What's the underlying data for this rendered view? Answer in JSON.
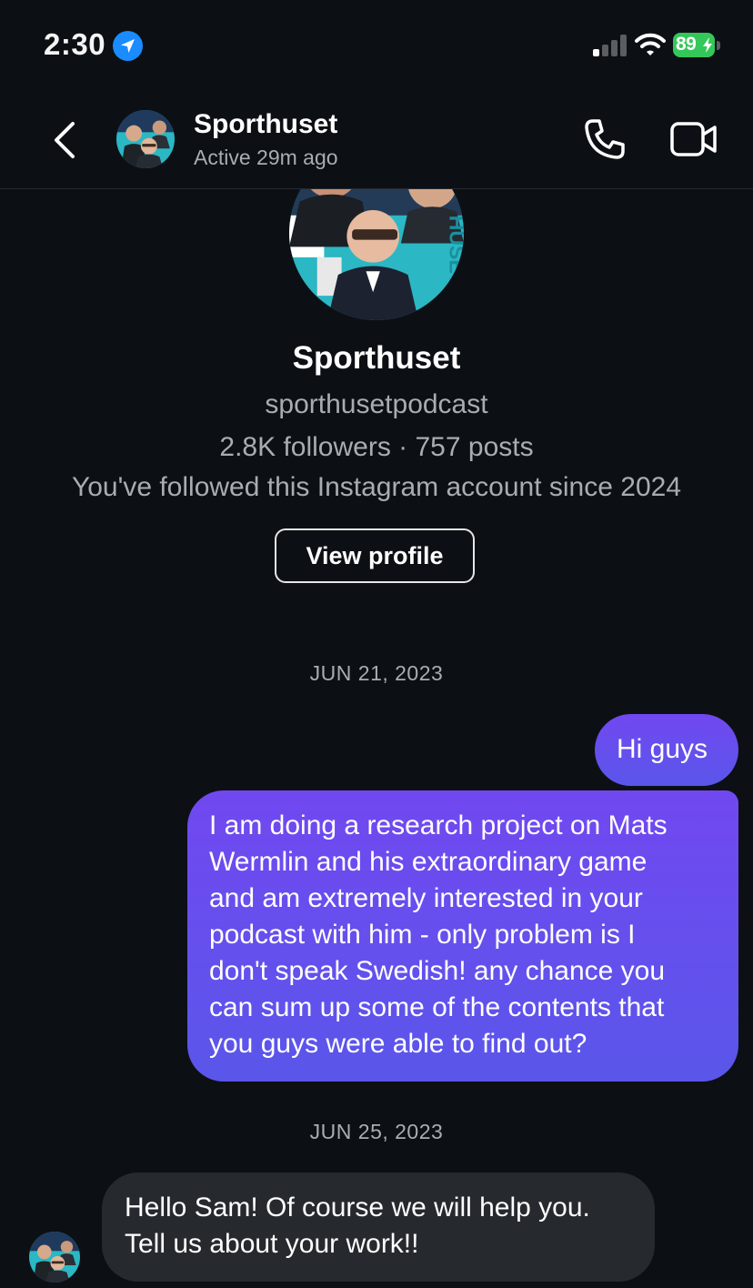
{
  "status_bar": {
    "time": "2:30",
    "battery": "89",
    "location_icon": "location-arrow-icon",
    "signal_icon": "cellular-signal-icon",
    "wifi_icon": "wifi-icon",
    "battery_color": "#34c759"
  },
  "header": {
    "name": "Sporthuset",
    "status": "Active 29m ago",
    "back_icon": "chevron-left-icon",
    "call_icon": "phone-icon",
    "video_icon": "video-camera-icon"
  },
  "profile": {
    "name": "Sporthuset",
    "username": "sporthusetpodcast",
    "stats": "2.8K followers · 757 posts",
    "follow_note": "You've followed this Instagram account since 2024",
    "view_profile_label": "View profile"
  },
  "conversation": {
    "date_1": "JUN 21, 2023",
    "date_2": "JUN 25, 2023",
    "messages": [
      {
        "direction": "outgoing",
        "text": "Hi guys"
      },
      {
        "direction": "outgoing",
        "text": "I am doing a research project on Mats\nWermlin and his extraordinary game\nand am extremely interested in your\npodcast with him - only problem is I\ndon't speak Swedish! any chance you\ncan sum up some of the contents that\nyou guys were able to find out?"
      },
      {
        "direction": "incoming",
        "text": "Hello Sam! Of course we will help you.\nTell us about your work!!"
      }
    ]
  },
  "colors": {
    "background": "#0c1014",
    "outgoing_bubble_top": "#7148f0",
    "outgoing_bubble_bottom": "#5a56ea",
    "incoming_bubble": "#26292e",
    "secondary_text": "#a8adb3",
    "brand_teal": "#2bb7c4"
  }
}
